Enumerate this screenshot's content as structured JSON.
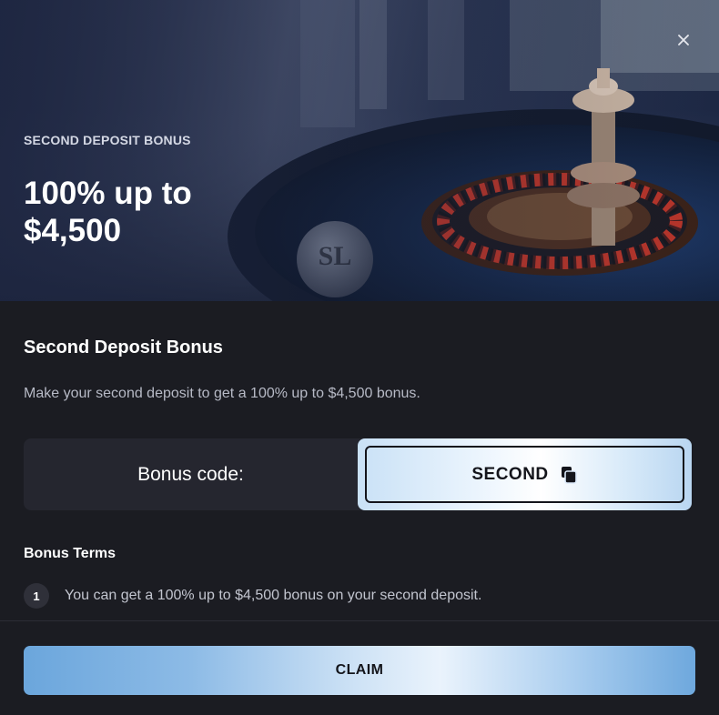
{
  "hero": {
    "eyebrow": "SECOND DEPOSIT BONUS",
    "title": "100% up to $4,500",
    "logo_text": "SL"
  },
  "bonus": {
    "title": "Second Deposit Bonus",
    "description": "Make your second deposit to get a 100% up to $4,500 bonus.",
    "code_label": "Bonus code:",
    "code_value": "SECOND"
  },
  "terms": {
    "title": "Bonus Terms",
    "items": [
      {
        "number": "1",
        "text": "You can get a 100% up to $4,500 bonus on your second deposit."
      }
    ]
  },
  "actions": {
    "claim_label": "CLAIM"
  },
  "icons": {
    "close": "close-icon",
    "copy": "copy-icon"
  },
  "colors": {
    "background": "#1b1c22",
    "panel": "#25262f",
    "accent_blue": "#6ba6dc",
    "text_muted": "#b7bac6"
  }
}
